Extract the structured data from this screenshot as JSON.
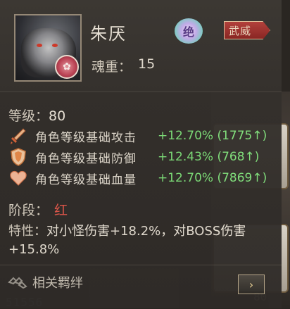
{
  "character": {
    "name": "朱厌",
    "soul_weight_label": "魂重：",
    "soul_weight_value": "15",
    "rarity_glyph": "绝",
    "tag": "武威"
  },
  "level": {
    "label": "等级：",
    "value": "80"
  },
  "stats": [
    {
      "label": "角色等级基础攻击",
      "value": "+12.70% (1775↑)",
      "icon": "sword-icon"
    },
    {
      "label": "角色等级基础防御",
      "value": "+12.43% (768↑)",
      "icon": "shield-icon"
    },
    {
      "label": "角色等级基础血量",
      "value": "+12.70% (7869↑)",
      "icon": "heart-icon"
    }
  ],
  "stage": {
    "label": "阶段：",
    "value": "红"
  },
  "trait": {
    "label": "特性：",
    "text": "对小怪伤害+18.2%，对BOSS伤害+15.8%"
  },
  "related": {
    "label": "相关羁绊",
    "arrow": "›"
  },
  "background": {
    "number_right": "80",
    "number_left": "51556"
  },
  "colors": {
    "stat_green": "#7fe07a",
    "stage_red": "#e4584c",
    "panel": "#34302c"
  }
}
